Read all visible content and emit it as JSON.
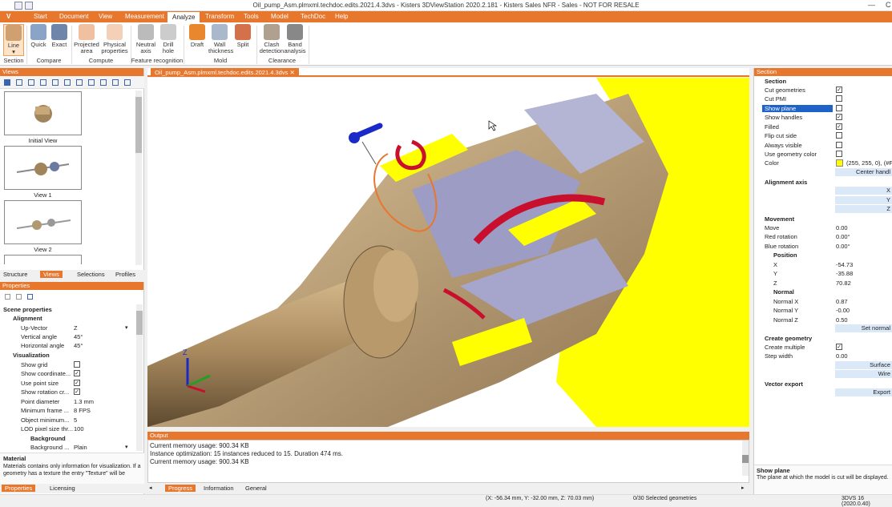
{
  "window": {
    "title": "Oil_pump_Asm.plmxml.techdoc.edits.2021.4.3dvs - Kisters 3DViewStation 2020.2.181 - Kisters Sales NFR - Sales - NOT FOR RESALE",
    "minimize": "—",
    "close_partial": "C"
  },
  "ribbon_tabs": [
    "Start",
    "Document",
    "View",
    "Measurement",
    "Analyze",
    "Transform",
    "Tools",
    "Model",
    "TechDoc",
    "Help"
  ],
  "active_tab": "Analyze",
  "app_menu": "V",
  "ribbon": {
    "buttons": [
      {
        "label": "Line",
        "sub": "▾",
        "icon": "section-line-icon"
      },
      {
        "label": "Quick",
        "icon": "compare-quick-icon"
      },
      {
        "label": "Exact",
        "icon": "compare-exact-icon"
      },
      {
        "label": "Projected area",
        "icon": "projected-area-icon"
      },
      {
        "label": "Physical properties",
        "icon": "physical-properties-icon"
      },
      {
        "label": "Neutral axis",
        "icon": "neutral-axis-icon"
      },
      {
        "label": "Drill hole",
        "icon": "drill-hole-icon"
      },
      {
        "label": "Draft",
        "icon": "draft-icon"
      },
      {
        "label": "Wall thickness",
        "icon": "wall-thickness-icon"
      },
      {
        "label": "Split",
        "icon": "split-icon"
      },
      {
        "label": "Clash detection",
        "icon": "clash-detection-icon"
      },
      {
        "label": "Band analysis",
        "icon": "band-analysis-icon"
      }
    ],
    "groups": [
      "Section",
      "Compare",
      "Compute",
      "Feature recognition",
      "Mold",
      "Clearance"
    ]
  },
  "views_panel": {
    "title": "Views",
    "thumbnails": [
      "Initial View",
      "View 1",
      "View 2"
    ],
    "tabs": [
      "Structure",
      "Views",
      "Selections",
      "Profiles"
    ]
  },
  "properties_panel": {
    "title": "Properties",
    "scene_header": "Scene properties",
    "alignment_header": "Alignment",
    "up_vector": {
      "label": "Up-Vector",
      "value": "Z"
    },
    "vertical_angle": {
      "label": "Vertical angle",
      "value": "45°"
    },
    "horizontal_angle": {
      "label": "Horizontal angle",
      "value": "45°"
    },
    "visualization_header": "Visualization",
    "show_grid": "Show grid",
    "show_coord": "Show coordinate...",
    "use_point_size": "Use point size",
    "show_rotation": "Show rotation cr...",
    "point_diameter": {
      "label": "Point diameter",
      "value": "1.3 mm"
    },
    "min_frame": {
      "label": "Minimum frame ...",
      "value": "8 FPS"
    },
    "object_min": {
      "label": "Object minimum...",
      "value": "5"
    },
    "lod": {
      "label": "LOD pixel size thr...",
      "value": "100"
    },
    "background_header": "Background",
    "background": {
      "label": "Background ...",
      "value": "Plain"
    },
    "material_title": "Material",
    "material_desc": "Materials contains only information for visualization. If a geometry has a texture the entry \"Texture\" will be",
    "tabs": [
      "Properties",
      "Licensing"
    ]
  },
  "document_tab": "Oil_pump_Asm.plmxml.techdoc.edits.2021.4.3dvs",
  "output": {
    "title": "Output",
    "lines": [
      "Current memory usage: 900.34 KB",
      "Instance optimization: 15 instances reduced to 15. Duration 474 ms.",
      "Current memory usage: 900.34 KB"
    ],
    "tabs": [
      "Progress",
      "Information",
      "General"
    ]
  },
  "section_panel": {
    "title": "Section",
    "section_header": "Section",
    "cut_geometries": "Cut geometries",
    "cut_pmi": "Cut PMI",
    "show_plane": "Show plane",
    "show_handles": "Show handles",
    "filled": "Filled",
    "flip_cut_side": "Flip cut side",
    "always_visible": "Always visible",
    "use_geometry_color": "Use geometry color",
    "color": {
      "label": "Color",
      "value": "(255, 255, 0), (#FFF"
    },
    "center_handle": "Center handl",
    "alignment_axis": "Alignment axis",
    "axes": [
      "X",
      "Y",
      "Z"
    ],
    "movement": "Movement",
    "move": {
      "label": "Move",
      "value": "0.00"
    },
    "red_rotation": {
      "label": "Red rotation",
      "value": "0.00°"
    },
    "blue_rotation": {
      "label": "Blue rotation",
      "value": "0.00°"
    },
    "position": "Position",
    "pos_x": {
      "label": "X",
      "value": "-54.73"
    },
    "pos_y": {
      "label": "Y",
      "value": "-35.88"
    },
    "pos_z": {
      "label": "Z",
      "value": "70.82"
    },
    "normal": "Normal",
    "normal_x": {
      "label": "Normal X",
      "value": "0.87"
    },
    "normal_y": {
      "label": "Normal Y",
      "value": "-0.00"
    },
    "normal_z": {
      "label": "Normal Z",
      "value": "0.50"
    },
    "set_normal": "Set normal",
    "create_geometry": "Create geometry",
    "create_multiple": "Create multiple",
    "step_width": {
      "label": "Step width",
      "value": "0.00"
    },
    "surface": "Surface",
    "wire": "Wire",
    "vector_export": "Vector export",
    "export": "Export",
    "help_title": "Show plane",
    "help_desc": "The plane at which the model is cut will be displayed."
  },
  "status": {
    "coords": "(X: -56.34 mm, Y: -32.00 mm, Z: 70.03 mm)",
    "selected": "0/30 Selected geometries",
    "version": "3DVS 16 (2020.0.40)"
  },
  "axis_labels": {
    "z": "Z"
  },
  "colors": {
    "accent": "#e8772e",
    "section_fill": "#ffff00",
    "part": "#c9a878",
    "inner": "#9c9cc4",
    "highlight": "#c8102e"
  }
}
